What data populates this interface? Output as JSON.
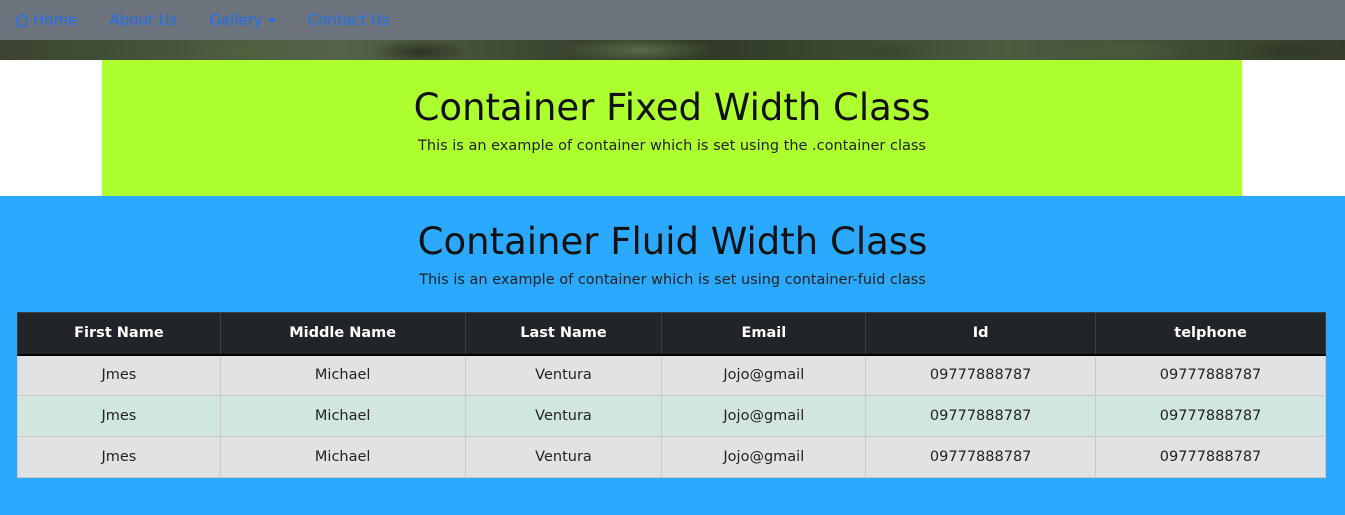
{
  "nav": {
    "home": "Home",
    "about": "About Us",
    "gallery": "Gallery",
    "contact": "Contact Us"
  },
  "fixed": {
    "title": "Container Fixed Width Class",
    "subtitle": "This is an example of container which is set using the .container class"
  },
  "fluid": {
    "title": "Container Fluid Width Class",
    "subtitle": "This is an example of container which is set using container-fuid class"
  },
  "table": {
    "headers": [
      "First Name",
      "Middle Name",
      "Last Name",
      "Email",
      "Id",
      "telphone"
    ],
    "rows": [
      [
        "Jmes",
        "Michael",
        "Ventura",
        "Jojo@gmail",
        "09777888787",
        "09777888787"
      ],
      [
        "Jmes",
        "Michael",
        "Ventura",
        "Jojo@gmail",
        "09777888787",
        "09777888787"
      ],
      [
        "Jmes",
        "Michael",
        "Ventura",
        "Jojo@gmail",
        "09777888787",
        "09777888787"
      ]
    ]
  },
  "colors": {
    "navbar": "#6c737d",
    "link": "#1e6ff0",
    "fixed_bg": "#adff2f",
    "fluid_bg": "#2aa9ff",
    "table_head": "#212529",
    "row_default": "#e1e2e4",
    "row_success": "#d1e7dd"
  },
  "icons": {
    "home": "house-icon",
    "gallery": "caret-down-icon"
  }
}
